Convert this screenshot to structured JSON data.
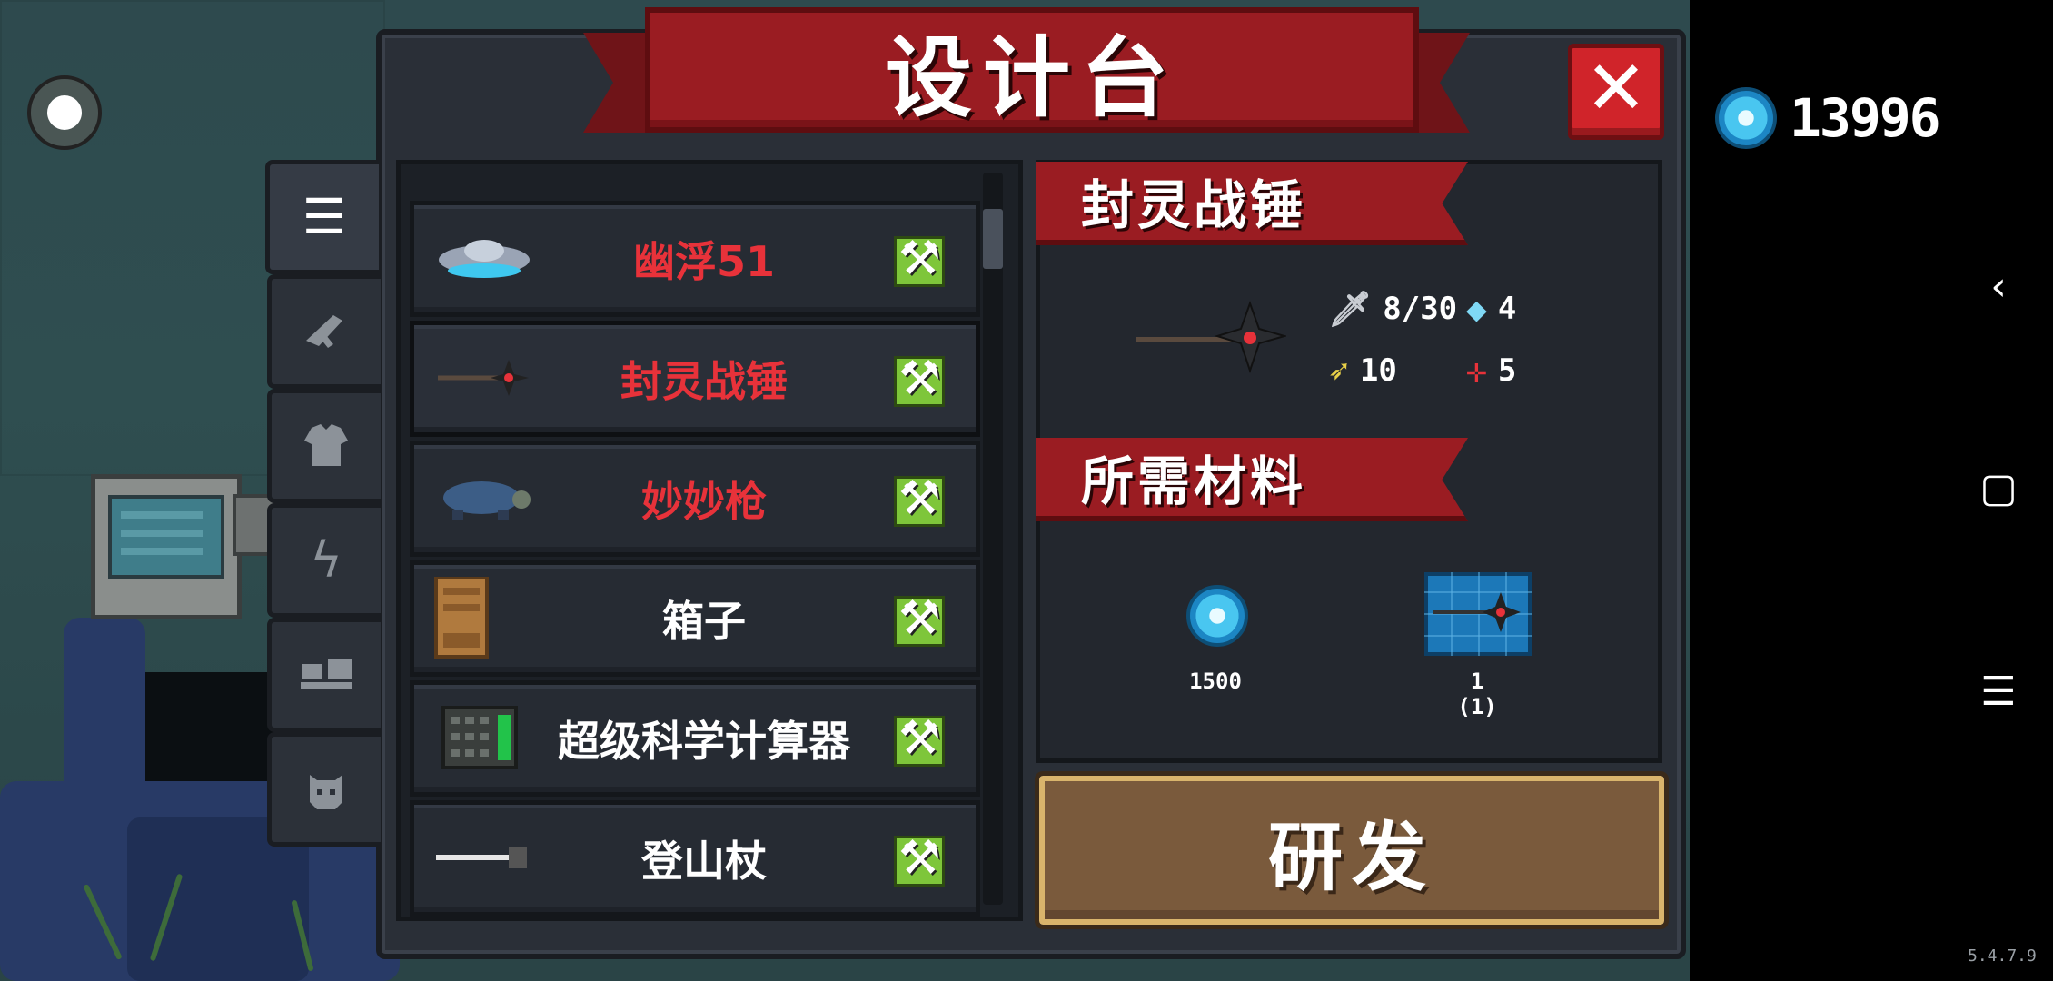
{
  "window": {
    "title": "设计台",
    "close_icon": "close-icon"
  },
  "currency": {
    "icon": "gem-icon",
    "amount": "13996"
  },
  "tabs": [
    {
      "icon": "list-icon",
      "active": true
    },
    {
      "icon": "gun-icon",
      "active": false
    },
    {
      "icon": "armor-icon",
      "active": false
    },
    {
      "icon": "lightning-icon",
      "active": false
    },
    {
      "icon": "furniture-icon",
      "active": false
    },
    {
      "icon": "pet-icon",
      "active": false
    }
  ],
  "list": [
    {
      "name": "幽浮51",
      "color": "red",
      "thumb": "ufo-icon"
    },
    {
      "name": "封灵战锤",
      "color": "red",
      "thumb": "hammer-icon"
    },
    {
      "name": "妙妙枪",
      "color": "red",
      "thumb": "turtle-gun-icon"
    },
    {
      "name": "箱子",
      "color": "white",
      "thumb": "box-icon"
    },
    {
      "name": "超级科学计算器",
      "color": "white",
      "thumb": "calculator-icon"
    },
    {
      "name": "登山杖",
      "color": "white",
      "thumb": "stick-icon"
    }
  ],
  "detail": {
    "title": "封灵战锤",
    "stats": {
      "damage": "8/30",
      "energy": "4",
      "speed": "10",
      "crit": "5"
    },
    "materials_title": "所需材料",
    "materials": [
      {
        "icon": "gem-icon",
        "amount": "1500"
      },
      {
        "icon": "blueprint-icon",
        "amount": "1",
        "owned": "(1)"
      }
    ],
    "research_label": "研发"
  },
  "version": "5.4.7.9",
  "colors": {
    "accent_red": "#9a1c22",
    "craft_green": "#7ec63a",
    "button_brown": "#7a5a3c"
  }
}
